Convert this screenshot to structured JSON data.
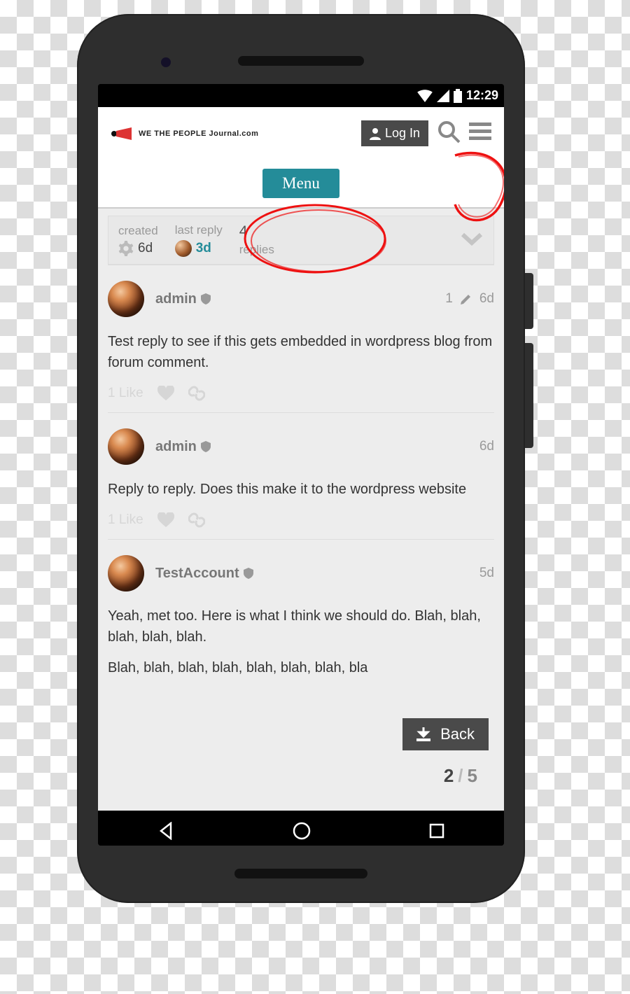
{
  "status": {
    "time": "12:29"
  },
  "header": {
    "logo_text": "WE THE PEOPLE Journal.com",
    "login_label": "Log In",
    "menu_label": "Menu"
  },
  "summary": {
    "created_label": "created",
    "created_value": "6d",
    "last_reply_label": "last reply",
    "last_reply_value": "3d",
    "replies_count": "4",
    "replies_label": "replies"
  },
  "posts": [
    {
      "user": "admin",
      "is_mod": true,
      "age": "6d",
      "edits": "1",
      "body": "Test reply to see if this gets embedded in wordpress blog from forum comment.",
      "likes": "1 Like"
    },
    {
      "user": "admin",
      "is_mod": true,
      "age": "6d",
      "body": "Reply to reply. Does this make it to the wordpress website",
      "likes": "1 Like"
    },
    {
      "user": "TestAccount",
      "is_mod": true,
      "age": "5d",
      "body": "Yeah, met too. Here is what I think we should do. Blah, blah, blah, blah, blah.",
      "body2": "Blah, blah, blah, blah, blah, blah, blah, bla"
    }
  ],
  "back_label": "Back",
  "pager": {
    "current": "2",
    "total": "5"
  }
}
